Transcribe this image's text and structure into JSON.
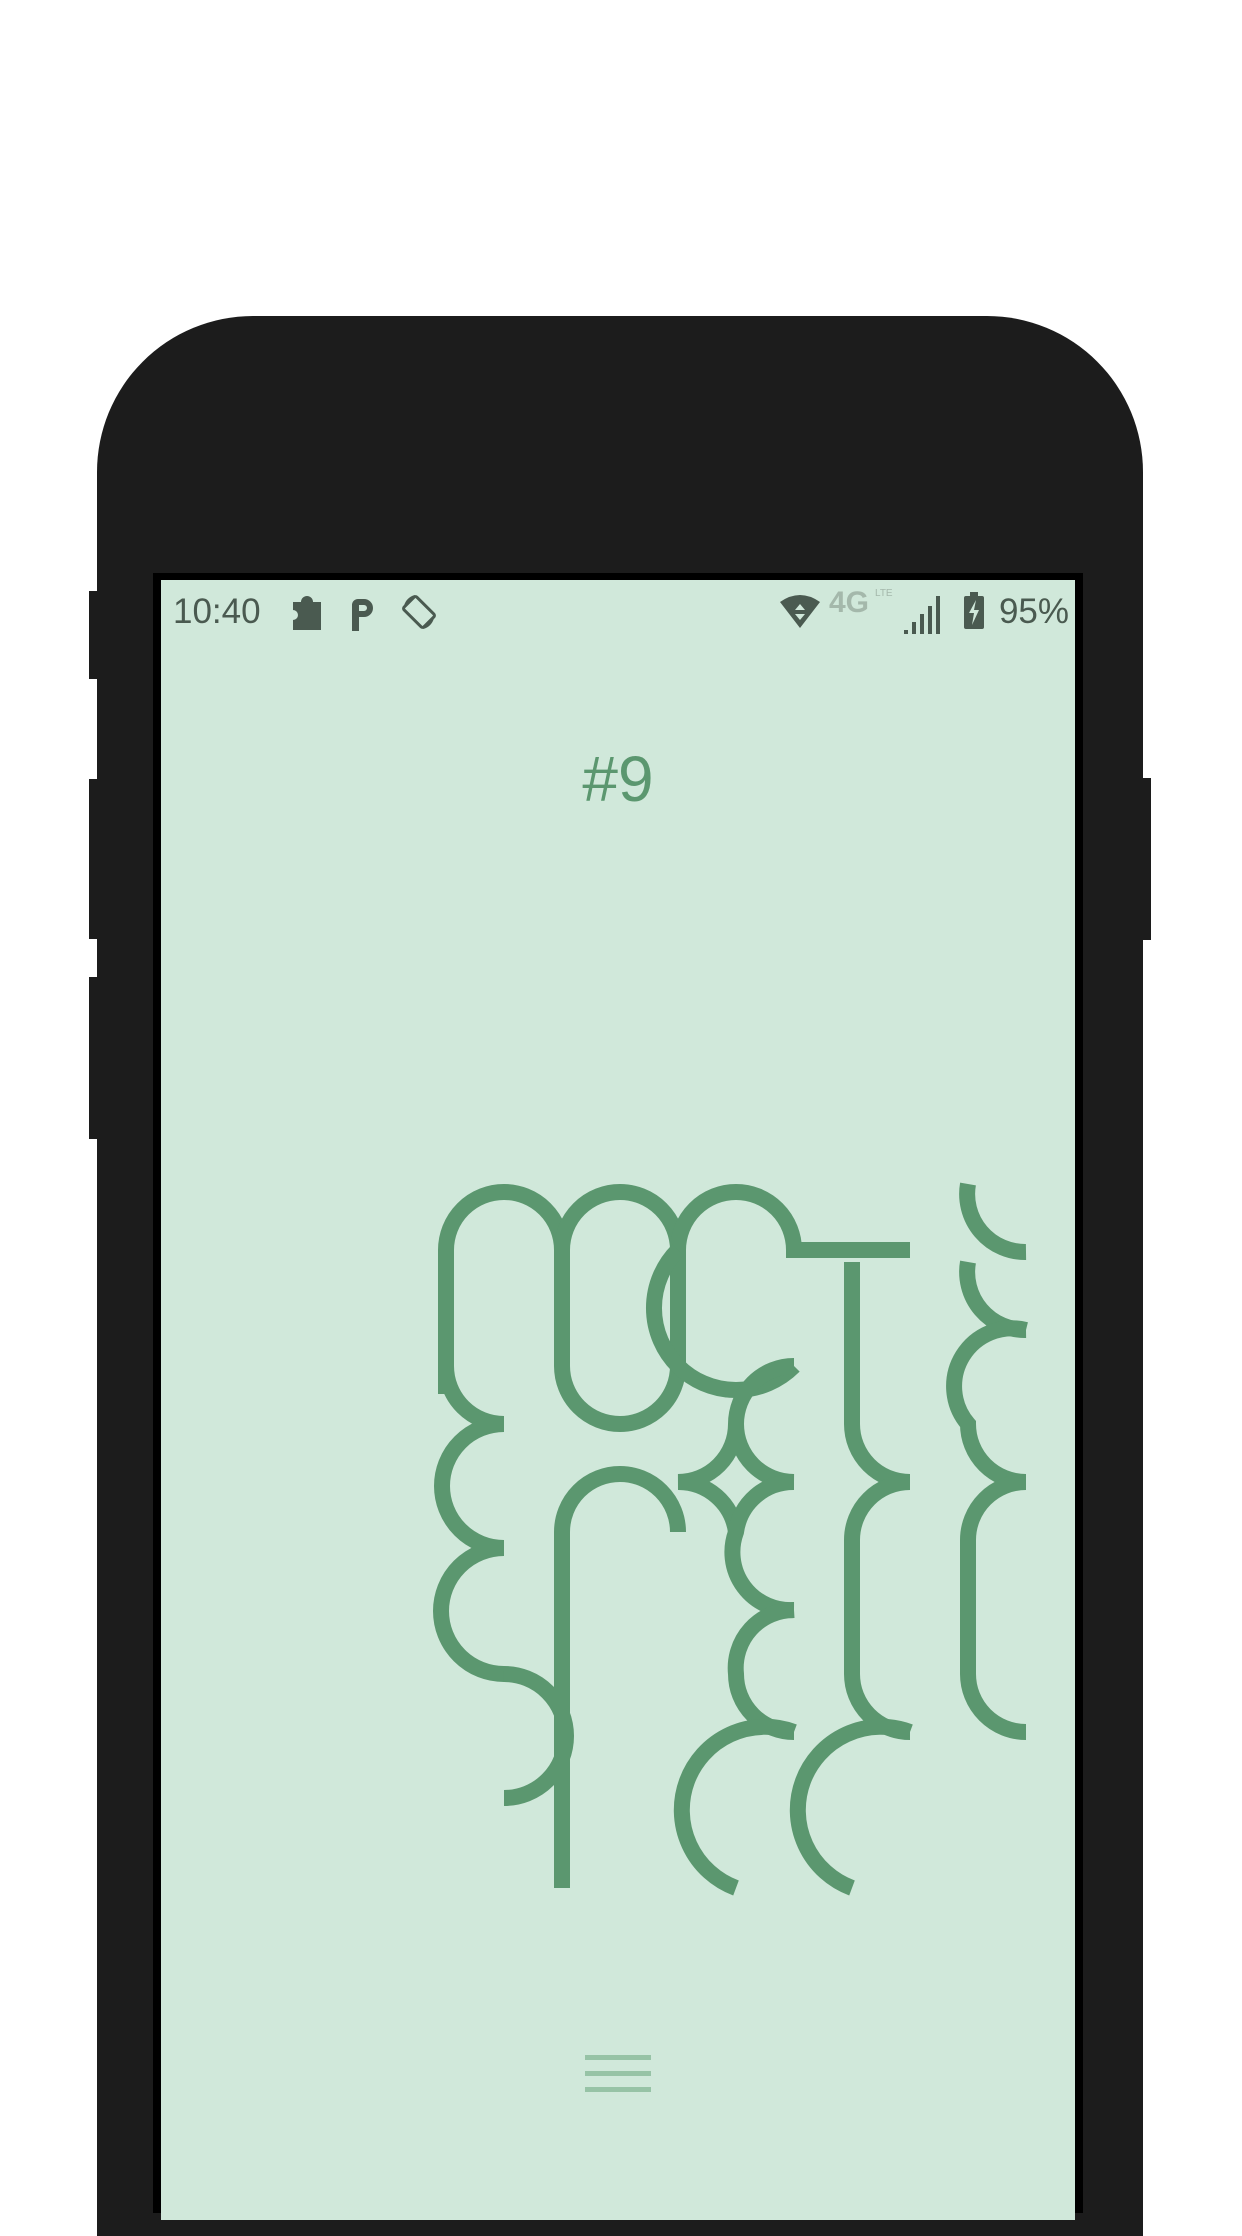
{
  "status_bar": {
    "time": "10:40",
    "left_icons": [
      "puzzle-icon",
      "parking-icon",
      "screen-rotation-icon"
    ],
    "network_label": "4G",
    "network_sub": "LTE",
    "right_icons": [
      "wifi-icon",
      "cell-signal-icon",
      "battery-charging-icon"
    ],
    "battery_percent": "95%"
  },
  "level": {
    "title": "#9"
  },
  "colors": {
    "background": "#d0e8da",
    "stroke": "#5b976f",
    "menu": "#97c3a6",
    "status_icons": "#4a5a50"
  },
  "menu": {
    "icon": "hamburger-menu-icon"
  }
}
